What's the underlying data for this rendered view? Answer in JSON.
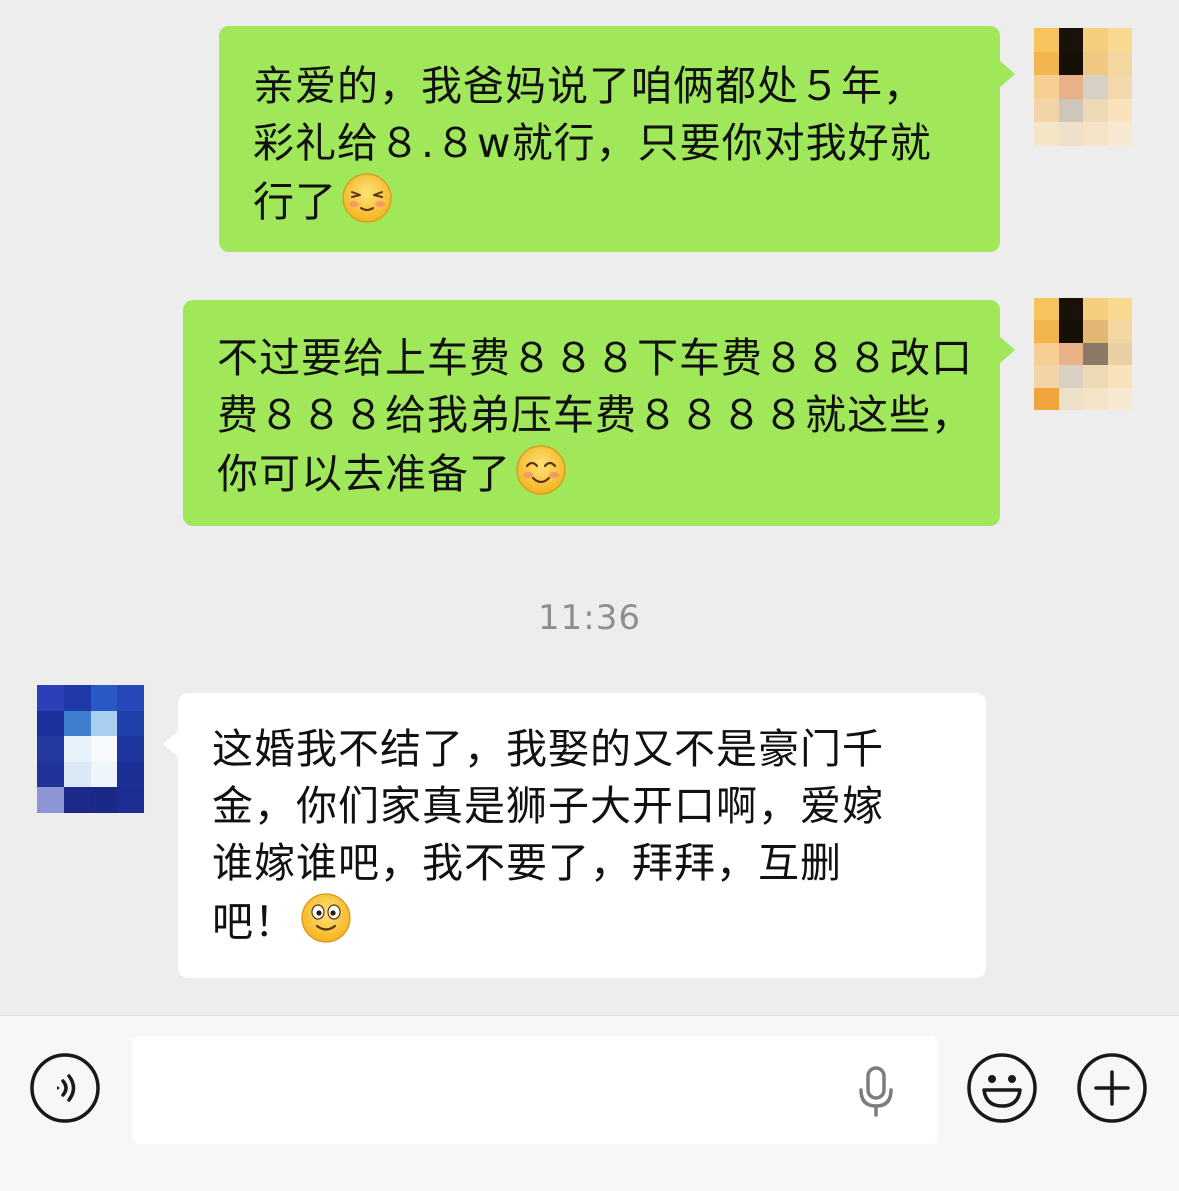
{
  "messages": [
    {
      "direction": "sent",
      "lines": [
        "亲爱的，我爸妈说了咱俩都处５年，",
        "彩礼给８.８w就行，只要你对我好就",
        "行了"
      ],
      "emoji": "smiling-blushing-eyes-closed-emoji"
    },
    {
      "direction": "sent",
      "lines": [
        "不过要给上车费８８８下车费８８８改口",
        "费８８８给我弟压车费８８８８就这些，",
        "你可以去准备了"
      ],
      "emoji": "smiling-blush-emoji"
    },
    {
      "direction": "received",
      "lines": [
        "这婚我不结了，我娶的又不是豪门千",
        "金，你们家真是狮子大开口啊，爱嫁",
        "谁嫁谁吧，我不要了，拜拜，互删",
        "吧！"
      ],
      "emoji": "wide-eyed-smile-emoji"
    }
  ],
  "timestamp": "11:36",
  "input": {
    "value": "",
    "voice_icon": "voice-toggle-icon",
    "mic_icon": "microphone-icon",
    "emoji_icon": "emoji-icon",
    "add_icon": "plus-icon"
  },
  "colors": {
    "background": "#ededed",
    "sent_bubble": "#a0e75a",
    "received_bubble": "#ffffff",
    "timestamp_text": "#8f8f8f"
  }
}
